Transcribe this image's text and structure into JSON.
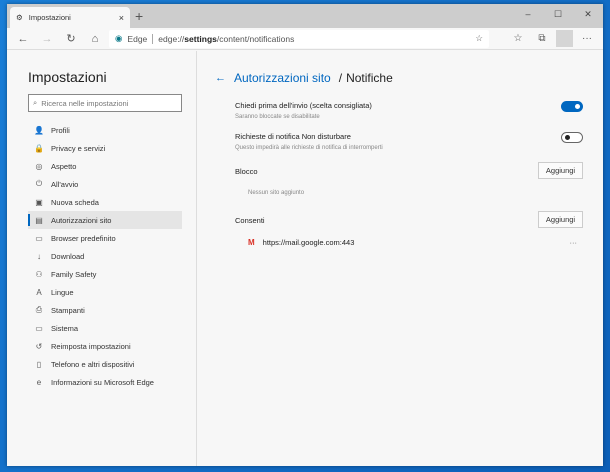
{
  "tab": {
    "title": "Impostazioni",
    "close": "×",
    "new": "+"
  },
  "window": {
    "min": "–",
    "max": "☐",
    "close": "✕"
  },
  "address": {
    "brand": "Edge",
    "url_prefix": "edge://",
    "url_bold": "settings",
    "url_suffix": "/content/notifications"
  },
  "sidebar": {
    "title": "Impostazioni",
    "search_placeholder": "Ricerca nelle impostazioni",
    "items": [
      {
        "label": "Profili",
        "icon": "👤"
      },
      {
        "label": "Privacy e servizi",
        "icon": "🔒"
      },
      {
        "label": "Aspetto",
        "icon": "◎"
      },
      {
        "label": "All'avvio",
        "icon": "⏻"
      },
      {
        "label": "Nuova scheda",
        "icon": "▣"
      },
      {
        "label": "Autorizzazioni sito",
        "icon": "▤"
      },
      {
        "label": "Browser predefinito",
        "icon": "▭"
      },
      {
        "label": "Download",
        "icon": "↓"
      },
      {
        "label": "Family Safety",
        "icon": "⚇"
      },
      {
        "label": "Lingue",
        "icon": "A"
      },
      {
        "label": "Stampanti",
        "icon": "⎙"
      },
      {
        "label": "Sistema",
        "icon": "▭"
      },
      {
        "label": "Reimposta impostazioni",
        "icon": "↺"
      },
      {
        "label": "Telefono e altri dispositivi",
        "icon": "▯"
      },
      {
        "label": "Informazioni su Microsoft Edge",
        "icon": "e"
      }
    ],
    "active": 5
  },
  "main": {
    "breadcrumb_link": "Autorizzazioni sito",
    "breadcrumb_sep": "/",
    "title": "Notifiche",
    "ask": {
      "label": "Chiedi prima dell'invio (scelta consigliata)",
      "sub": "Saranno bloccate se disabilitate",
      "on": true
    },
    "dnd": {
      "label": "Richieste di notifica Non disturbare",
      "sub": "Questo impedirà alle richieste di notifica di interromperti",
      "on": false
    },
    "block": {
      "label": "Blocco",
      "button": "Aggiungi",
      "empty": "Nessun sito aggiunto"
    },
    "allow": {
      "label": "Consenti",
      "button": "Aggiungi",
      "sites": [
        {
          "url": "https://mail.google.com:443",
          "icon": "M"
        }
      ]
    },
    "more": "···"
  },
  "colors": {
    "accent": "#0067c0"
  }
}
